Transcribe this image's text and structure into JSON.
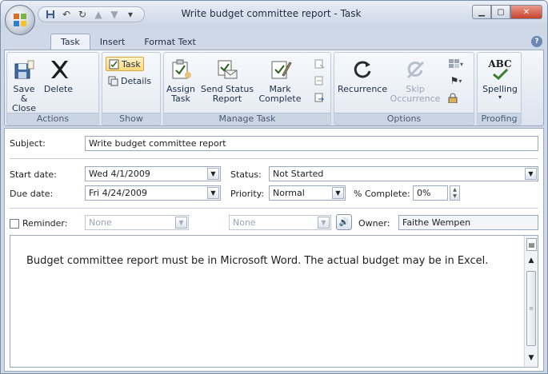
{
  "window": {
    "title": "Write budget committee report - Task"
  },
  "ribbon": {
    "tabs": [
      "Task",
      "Insert",
      "Format Text"
    ],
    "groups": {
      "actions": {
        "label": "Actions",
        "save_close_line1": "Save &",
        "save_close_line2": "Close",
        "delete": "Delete"
      },
      "show": {
        "label": "Show",
        "task": "Task",
        "details": "Details"
      },
      "manage": {
        "label": "Manage Task",
        "assign_line1": "Assign",
        "assign_line2": "Task",
        "send_line1": "Send Status",
        "send_line2": "Report",
        "mark_line1": "Mark",
        "mark_line2": "Complete"
      },
      "options": {
        "label": "Options",
        "recurrence": "Recurrence",
        "skip_line1": "Skip",
        "skip_line2": "Occurrence"
      },
      "proofing": {
        "label": "Proofing",
        "spelling": "Spelling",
        "abc": "ABC"
      }
    }
  },
  "form": {
    "subject_label": "Subject:",
    "subject_value": "Write budget committee report",
    "start_label": "Start date:",
    "start_value": "Wed 4/1/2009",
    "due_label": "Due date:",
    "due_value": "Fri 4/24/2009",
    "status_label": "Status:",
    "status_value": "Not Started",
    "priority_label": "Priority:",
    "priority_value": "Normal",
    "complete_label": "% Complete:",
    "complete_value": "0%",
    "reminder_label": "Reminder:",
    "reminder_date": "None",
    "reminder_time": "None",
    "owner_label": "Owner:",
    "owner_value": "Faithe Wempen"
  },
  "notes": {
    "text": "Budget committee report must be in Microsoft Word. The actual budget may be in Excel."
  },
  "colors": {
    "frame": "#cfd8e6",
    "ribbon_border": "#9aa9c0",
    "active_button": "#ffd97a",
    "close_button": "#c8432e"
  }
}
